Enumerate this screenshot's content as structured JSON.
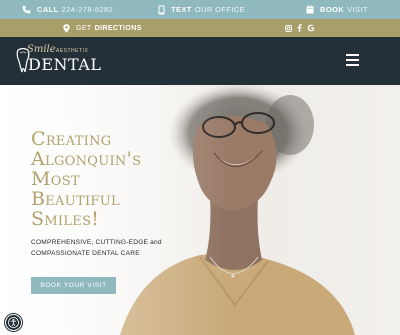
{
  "topbar": {
    "call_label": "CALL",
    "call_number": "224-278-8282",
    "text_label": "TEXT",
    "text_rest": "OUR OFFICE",
    "book_label": "BOOK",
    "book_rest": "VISIT",
    "icons": [
      "phone-icon",
      "mobile-icon",
      "calendar-icon"
    ]
  },
  "directions": {
    "prefix": "GET",
    "label": "DIRECTIONS",
    "icon": "location-pin-icon",
    "social_icons": [
      "instagram-icon",
      "facebook-icon",
      "google-icon"
    ]
  },
  "header": {
    "logo_smile": "Smile",
    "logo_aesthetix": "AESTHETIX",
    "logo_dental": "DENTAL",
    "menu_icon": "hamburger-menu-icon"
  },
  "hero": {
    "headline_lines": [
      "Creating",
      "Algonquin's",
      "Most",
      "Beautiful",
      "Smiles!"
    ],
    "subtext": "COMPREHENSIVE, CUTTING-EDGE and COMPASSIONATE DENTAL CARE",
    "cta_label": "BOOK YOUR VISIT"
  },
  "colors": {
    "topbar": "#8fb8bf",
    "directions_bar": "#a89e6a",
    "header": "#243038",
    "headline": "#b1a16b",
    "button": "#8fb8bf"
  },
  "accessibility": {
    "icon": "accessibility-icon"
  }
}
